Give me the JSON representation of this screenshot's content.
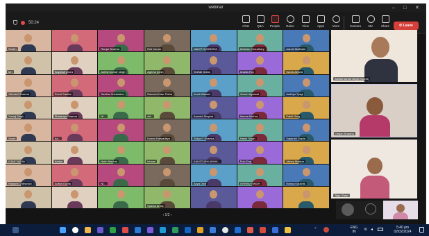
{
  "window": {
    "title": "webinar"
  },
  "meeting": {
    "duration": "50:24"
  },
  "toolbar": {
    "buttons": [
      {
        "label": "Chat"
      },
      {
        "label": "Q&A"
      },
      {
        "label": "People"
      },
      {
        "label": "Raise"
      },
      {
        "label": "View"
      },
      {
        "label": "Apps"
      },
      {
        "label": "More"
      },
      {
        "label": "Camera"
      },
      {
        "label": "Mic"
      },
      {
        "label": "Share"
      }
    ],
    "leave_label": "Leave",
    "active_button": "People"
  },
  "grid_tiles": [
    {
      "name": "Shubh"
    },
    {
      "name": ""
    },
    {
      "name": "Ranjai Sharma"
    },
    {
      "name": "Ruti Kumar"
    },
    {
      "name": "NAMITYA MISHRA"
    },
    {
      "name": "Abhinav Chaudhary"
    },
    {
      "name": "Aarohi Maithani"
    },
    {
      "name": "Mn"
    },
    {
      "name": "Sayansh Arora"
    },
    {
      "name": "Ashish kumar singh"
    },
    {
      "name": "Agrima Iyesh"
    },
    {
      "name": "Shefali Golas"
    },
    {
      "name": "Anaika Roy"
    },
    {
      "name": "Sarasi Anand"
    },
    {
      "name": "Vikmishi Sharma"
    },
    {
      "name": "Ruchi Sastha"
    },
    {
      "name": "Savitha Srivastava"
    },
    {
      "name": "Ravneet Kaur Plaha"
    },
    {
      "name": "Arush Bansal"
    },
    {
      "name": "Vivaan Agarwal"
    },
    {
      "name": "Aadhya Tyagi"
    },
    {
      "name": "Yuvraj Singh"
    },
    {
      "name": "Sharanya Sharma"
    },
    {
      "name": "Ni..."
    },
    {
      "name": "Ad..."
    },
    {
      "name": "Aarushi Singhal"
    },
    {
      "name": "Aasma Mishra"
    },
    {
      "name": "Pakhi Garg"
    },
    {
      "name": "Aarav"
    },
    {
      "name": "Aa..."
    },
    {
      "name": ""
    },
    {
      "name": "Kumar Kabyaditya"
    },
    {
      "name": "Shlpa G Sharma"
    },
    {
      "name": "Harsh Singh"
    },
    {
      "name": "Sayansh Gupta"
    },
    {
      "name": "OJAS YADAV"
    },
    {
      "name": "Aadya"
    },
    {
      "name": "Nalin Nischal"
    },
    {
      "name": "Ishaan"
    },
    {
      "name": "KAUSTUBH ADHIK..."
    },
    {
      "name": "Pulo Dua"
    },
    {
      "name": "Athary Makkar"
    },
    {
      "name": "Raslami Chitranshi"
    },
    {
      "name": "Aditya Gupta"
    },
    {
      "name": "Ni..."
    },
    {
      "name": ""
    },
    {
      "name": "Anya Dixit"
    },
    {
      "name": "VIKRAM SINGH"
    },
    {
      "name": "Manya Kaushik"
    },
    {
      "name": ""
    },
    {
      "name": ""
    },
    {
      "name": ""
    },
    {
      "name": "Sparsh Arora"
    },
    {
      "name": ""
    },
    {
      "name": ""
    },
    {
      "name": ""
    }
  ],
  "side_tiles": [
    {
      "name": "Ashish kumar singh (Guest)"
    },
    {
      "name": "Geljan Sharma"
    },
    {
      "name": "Tejpu Gaur"
    }
  ],
  "pager": {
    "label": "1/2"
  },
  "taskbar": {
    "lang_line1": "ENG",
    "lang_line2": "IN",
    "time": "5:40 pm",
    "date": "02/02/2024"
  },
  "colors": {
    "leave": "#d6403a",
    "taskbar": "#0c1d3b",
    "app_bg": "#141414"
  }
}
